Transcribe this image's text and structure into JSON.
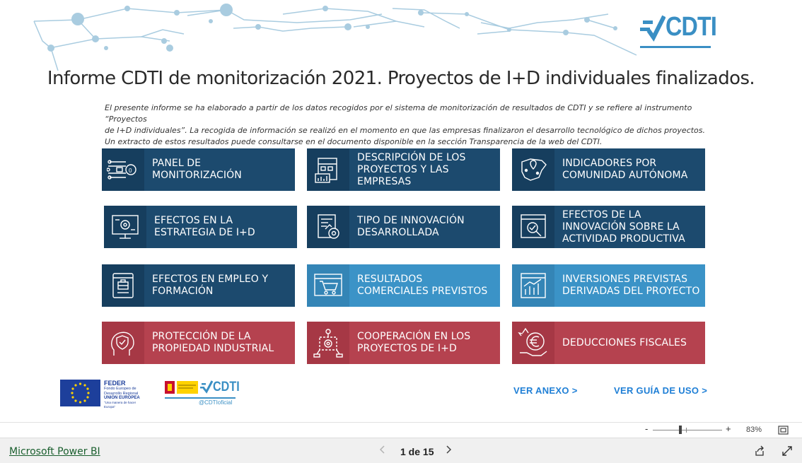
{
  "report": {
    "title": "Informe CDTI de monitorización 2021. Proyectos de I+D individuales finalizados.",
    "intro_lines": [
      "El presente informe se ha elaborado a partir de los datos recogidos por el sistema de monitorización de resultados de CDTI y se refiere al instrumento “Proyectos",
      "de I+D individuales”. La recogida de información se realizó en el momento en que las empresas finalizaron el desarrollo tecnológico de dichos proyectos.",
      "Un extracto de estos resultados puede consultarse en el documento disponible en la sección Transparencia de la web del CDTI."
    ],
    "logo_text": "CDTI",
    "colors": {
      "dark": "#1c4a6e",
      "light": "#3b93c7",
      "red": "#b5424f",
      "link": "#1f7fd6"
    }
  },
  "tiles": [
    {
      "label": "PANEL DE MONITORIZACIÓN",
      "icon": "circuit-brain-icon"
    },
    {
      "label": "DESCRIPCIÓN DE LOS PROYECTOS Y LAS EMPRESAS",
      "icon": "building-chart-icon"
    },
    {
      "label": "INDICADORES POR COMUNIDAD AUTÓNOMA",
      "icon": "spain-map-icon"
    },
    {
      "label": "EFECTOS EN LA ESTRATEGIA DE I+D",
      "icon": "monitor-gear-icon"
    },
    {
      "label": "TIPO DE INNOVACIÓN DESARROLLADA",
      "icon": "document-gear-icon"
    },
    {
      "label": "EFECTOS DE LA INNOVACIÓN SOBRE LA ACTIVIDAD PRODUCTIVA",
      "icon": "window-magnifier-icon"
    },
    {
      "label": "EFECTOS EN EMPLEO Y FORMACIÓN",
      "icon": "browser-briefcase-icon"
    },
    {
      "label": "RESULTADOS COMERCIALES PREVISTOS",
      "icon": "browser-cart-icon"
    },
    {
      "label": "INVERSIONES PREVISTAS DERIVADAS DEL PROYECTO",
      "icon": "browser-chart-icon"
    },
    {
      "label": "PROTECCIÓN DE LA PROPIEDAD INDUSTRIAL",
      "icon": "head-shield-icon"
    },
    {
      "label": "COOPERACIÓN EN LOS PROYECTOS DE I+D",
      "icon": "network-gear-icon"
    },
    {
      "label": "DEDUCCIONES FISCALES",
      "icon": "euro-hand-icon"
    }
  ],
  "links": {
    "anexo": "VER ANEXO >",
    "guia": "VER GUÍA DE USO >"
  },
  "footer_logos": {
    "eu": {
      "name": "FEDER",
      "line1": "Fondo Europeo de",
      "line2": "Desarrollo Regional",
      "line3": "UNIÓN EUROPEA",
      "motto": "\"Una manera de hacer Europa\""
    },
    "gov": {
      "cdti": "CDTI",
      "handle": "@CDTIoficial"
    }
  },
  "status": {
    "zoom": "83%",
    "zoom_minus": "-",
    "zoom_plus": "+"
  },
  "bottom": {
    "powerbi": "Microsoft Power BI",
    "page": "1 de 15"
  }
}
